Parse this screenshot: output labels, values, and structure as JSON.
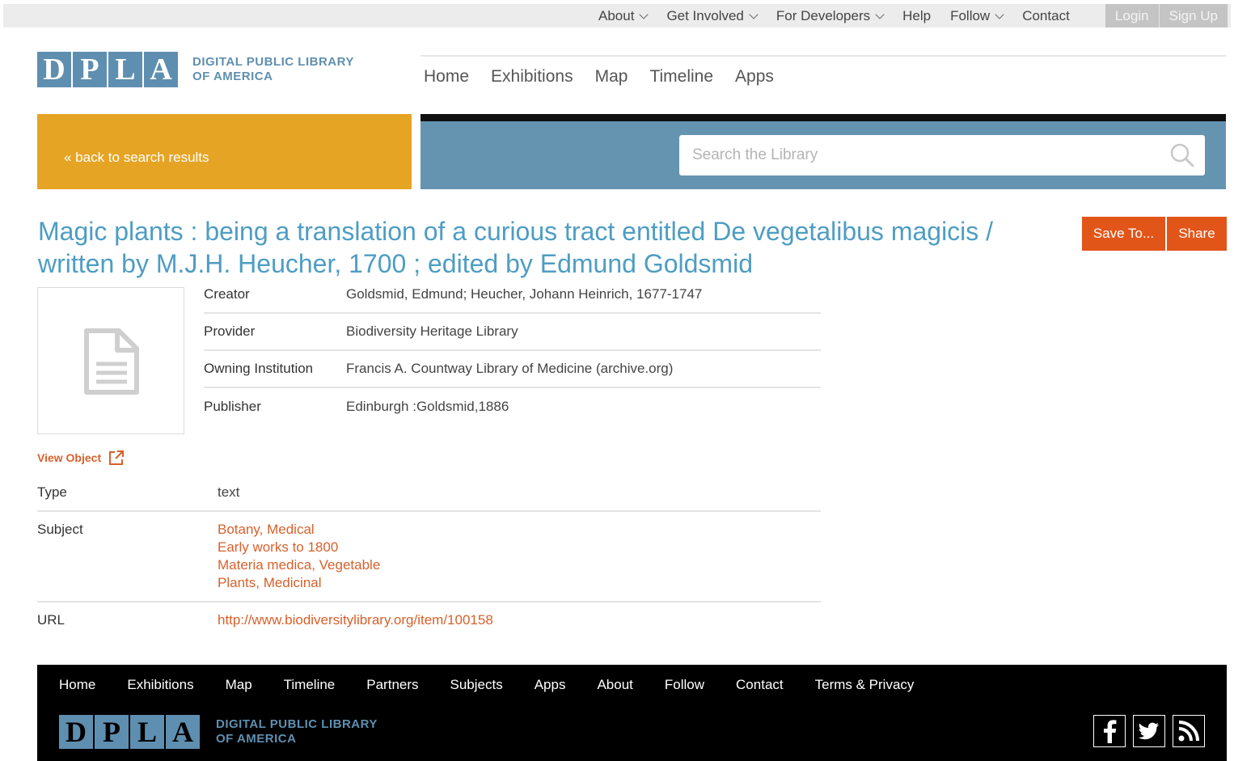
{
  "topbar": {
    "items": [
      {
        "label": "About",
        "has_caret": true
      },
      {
        "label": "Get Involved",
        "has_caret": true
      },
      {
        "label": "For Developers",
        "has_caret": true
      },
      {
        "label": "Help",
        "has_caret": false
      },
      {
        "label": "Follow",
        "has_caret": true
      },
      {
        "label": "Contact",
        "has_caret": false
      }
    ],
    "login_label": "Login",
    "signup_label": "Sign Up"
  },
  "logo": {
    "letters": [
      "D",
      "P",
      "L",
      "A"
    ],
    "line1": "DIGITAL PUBLIC LIBRARY",
    "line2": "OF AMERICA"
  },
  "main_nav": [
    "Home",
    "Exhibitions",
    "Map",
    "Timeline",
    "Apps"
  ],
  "banner": {
    "back_label": "« back to search results",
    "search_placeholder": "Search the Library"
  },
  "item": {
    "title": "Magic plants : being a translation of a curious tract entitled De vegetalibus magicis / written by M.J.H. Heucher, 1700 ; edited by Edmund Goldsmid",
    "save_label": "Save To...",
    "share_label": "Share",
    "view_object_label": "View Object",
    "meta_primary": [
      {
        "label": "Creator",
        "value": "Goldsmid, Edmund; Heucher, Johann Heinrich, 1677-1747"
      },
      {
        "label": "Provider",
        "value": "Biodiversity Heritage Library"
      },
      {
        "label": "Owning Institution",
        "value": "Francis A. Countway Library of Medicine (archive.org)"
      },
      {
        "label": "Publisher",
        "value": "Edinburgh :Goldsmid,1886"
      }
    ],
    "type_label": "Type",
    "type_value": "text",
    "subject_label": "Subject",
    "subjects": [
      "Botany, Medical",
      "Early works to 1800",
      "Materia medica, Vegetable",
      "Plants, Medicinal"
    ],
    "url_label": "URL",
    "url_value": "http://www.biodiversitylibrary.org/item/100158"
  },
  "footer": {
    "nav": [
      "Home",
      "Exhibitions",
      "Map",
      "Timeline",
      "Partners",
      "Subjects",
      "Apps",
      "About",
      "Follow",
      "Contact",
      "Terms & Privacy"
    ],
    "social": [
      "facebook-icon",
      "twitter-icon",
      "rss-icon"
    ]
  },
  "colors": {
    "brand_blue": "#5f8fb0",
    "title_blue": "#4e9dc3",
    "accent_orange": "#e25519",
    "link_orange": "#d8602b",
    "banner_gold": "#e6a424",
    "search_band": "#6594b1"
  }
}
